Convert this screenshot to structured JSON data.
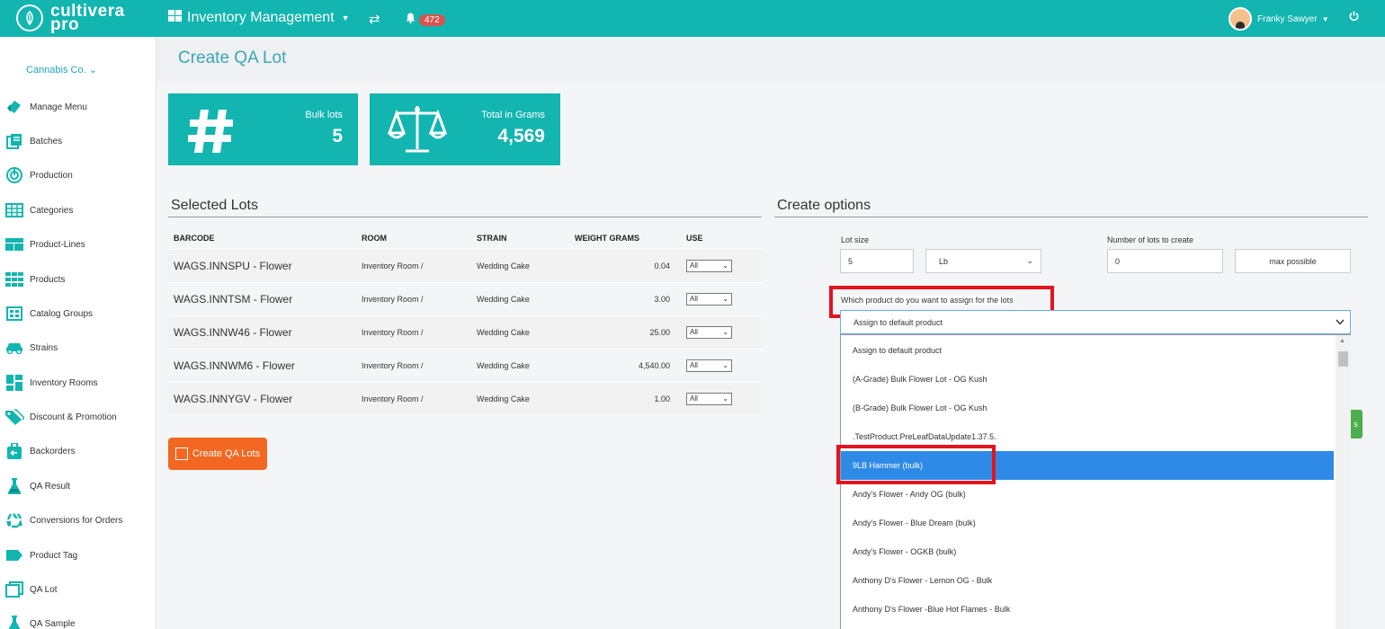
{
  "brand": {
    "line1": "cultivera",
    "line2": "pro"
  },
  "header": {
    "app_menu_label": "Inventory Management",
    "notification_count": "472",
    "user_name": "Franky Sawyer"
  },
  "sidebar": {
    "company": "Cannabis Co.",
    "items": [
      {
        "label": "Manage Menu",
        "icon": "tag-icon"
      },
      {
        "label": "Batches",
        "icon": "batches-icon"
      },
      {
        "label": "Production",
        "icon": "production-icon"
      },
      {
        "label": "Categories",
        "icon": "grid-table-icon"
      },
      {
        "label": "Product-Lines",
        "icon": "product-lines-icon"
      },
      {
        "label": "Products",
        "icon": "products-grid-icon"
      },
      {
        "label": "Catalog Groups",
        "icon": "catalog-icon"
      },
      {
        "label": "Strains",
        "icon": "car-icon"
      },
      {
        "label": "Inventory Rooms",
        "icon": "rooms-icon"
      },
      {
        "label": "Discount & Promotion",
        "icon": "discount-tag-icon"
      },
      {
        "label": "Backorders",
        "icon": "backorders-icon"
      },
      {
        "label": "QA Result",
        "icon": "flask-icon"
      },
      {
        "label": "Conversions for Orders",
        "icon": "recycle-icon"
      },
      {
        "label": "Product Tag",
        "icon": "label-icon"
      },
      {
        "label": "QA Lot",
        "icon": "copy-icon"
      },
      {
        "label": "QA Sample",
        "icon": "flask-icon"
      }
    ]
  },
  "page": {
    "title": "Create QA Lot"
  },
  "stats": {
    "bulk_lots_label": "Bulk lots",
    "bulk_lots_value": "5",
    "total_grams_label": "Total in Grams",
    "total_grams_value": "4,569"
  },
  "selected_lots": {
    "title": "Selected Lots",
    "columns": [
      "BARCODE",
      "ROOM",
      "STRAIN",
      "WEIGHT GRAMS",
      "USE"
    ],
    "rows": [
      {
        "barcode": "WAGS.INNSPU - Flower",
        "room": "Inventory Room /",
        "strain": "Wedding Cake",
        "weight": "0.04",
        "use": "All"
      },
      {
        "barcode": "WAGS.INNTSM - Flower",
        "room": "Inventory Room /",
        "strain": "Wedding Cake",
        "weight": "3.00",
        "use": "All"
      },
      {
        "barcode": "WAGS.INNW46 - Flower",
        "room": "Inventory Room /",
        "strain": "Wedding Cake",
        "weight": "25.00",
        "use": "All"
      },
      {
        "barcode": "WAGS.INNWM6 - Flower",
        "room": "Inventory Room /",
        "strain": "Wedding Cake",
        "weight": "4,540.00",
        "use": "All"
      },
      {
        "barcode": "WAGS.INNYGV - Flower",
        "room": "Inventory Room /",
        "strain": "Wedding Cake",
        "weight": "1.00",
        "use": "All"
      }
    ],
    "create_button": "Create QA Lots"
  },
  "create_options": {
    "title": "Create options",
    "lot_size_label": "Lot size",
    "lot_size_value": "5",
    "unit_value": "Lb",
    "num_lots_label": "Number of lots to create",
    "num_lots_value": "0",
    "max_possible_label": "max possible",
    "assign_label": "Which product do you want to assign for the lots",
    "product_selected": "Assign to default product",
    "options": [
      "Assign to default product",
      "(A-Grade) Bulk Flower Lot - OG Kush",
      "(B-Grade) Bulk Flower Lot - OG Kush",
      ".TestProduct.PreLeafDataUpdate1.37.5.",
      "9LB Hammer (bulk)",
      "Andy's Flower - Andy OG (bulk)",
      "Andy's Flower - Blue Dream (bulk)",
      "Andy's Flower - OGKB (bulk)",
      "Anthony D's Flower - Lemon OG - Bulk",
      "Anthony D's Flower -Blue Hot Flames - Bulk"
    ],
    "highlighted_option": "9LB Hammer (bulk)",
    "green_button_fragment": "s"
  },
  "colors": {
    "accent": "#12b5b0",
    "orange": "#f26722",
    "highlight": "#2e8ae6",
    "annotation_red": "#e3131f"
  }
}
